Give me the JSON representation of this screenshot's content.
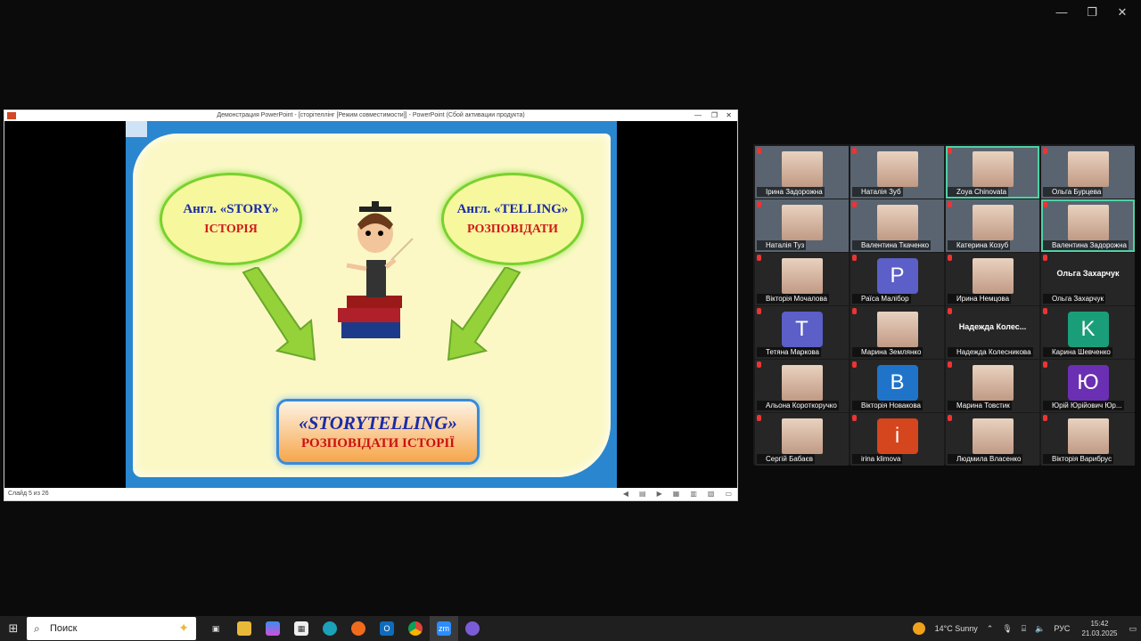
{
  "window_controls": {
    "minimize": "—",
    "maximize": "❐",
    "close": "✕"
  },
  "ppt": {
    "title": "Демонстрация PowerPoint - [сторітеллінг [Режим совместимости]] - PowerPoint (Сбой активации продукта)",
    "status": "Слайд 5 из 26",
    "slide": {
      "left_en": "Англ. «STORY»",
      "left_ua": "ІСТОРІЯ",
      "right_en": "Англ. «TELLING»",
      "right_ua": "РОЗПОВІДАТИ",
      "result_en": "«STORYTELLING»",
      "result_ua": "РОЗПОВІДАТИ ІСТОРІЇ"
    }
  },
  "participants": [
    {
      "name": "Ірина Задорожна",
      "type": "video"
    },
    {
      "name": "Наталія Зуб",
      "type": "video"
    },
    {
      "name": "Zoya Chinovata",
      "type": "video",
      "active": true
    },
    {
      "name": "Ольга Бурцева",
      "type": "video"
    },
    {
      "name": "Наталія Туз",
      "type": "video"
    },
    {
      "name": "Валентина Ткаченко",
      "type": "video"
    },
    {
      "name": "Катерина Козуб",
      "type": "video"
    },
    {
      "name": "Валентина Задорожна",
      "type": "video",
      "active": true
    },
    {
      "name": "Вікторія Мочалова",
      "type": "photo"
    },
    {
      "name": "Раїса Малібор",
      "type": "letter",
      "letter": "P",
      "color": "#5b5fc7"
    },
    {
      "name": "Ирина Немцова",
      "type": "photo"
    },
    {
      "name": "Ольга Захарчук",
      "type": "text",
      "big": "Ольга Захарчук"
    },
    {
      "name": "Тетяна Маркова",
      "type": "letter",
      "letter": "T",
      "color": "#5b5fc7"
    },
    {
      "name": "Марина Землянко",
      "type": "photo"
    },
    {
      "name": "Надежда Колесникова",
      "type": "text",
      "big": "Надежда  Колес..."
    },
    {
      "name": "Карина Шевченко",
      "type": "letter",
      "letter": "K",
      "color": "#1a9e7a"
    },
    {
      "name": "Альона Короткоручко",
      "type": "photo"
    },
    {
      "name": "Вікторія Новакова",
      "type": "letter",
      "letter": "B",
      "color": "#1f74c9"
    },
    {
      "name": "Марина Товстик",
      "type": "photo"
    },
    {
      "name": "Юрій Юрійович Юр...",
      "type": "letter",
      "letter": "Ю",
      "color": "#6b2fb3"
    },
    {
      "name": "Сергій Бабаєв",
      "type": "photo"
    },
    {
      "name": "irina klimova",
      "type": "letter",
      "letter": "i",
      "color": "#d5451e"
    },
    {
      "name": "Людмила Власенко",
      "type": "photo"
    },
    {
      "name": "Вікторія Варибрус",
      "type": "photo"
    }
  ],
  "taskbar": {
    "search_label": "Поиск",
    "weather": "14°C  Sunny",
    "lang": "РУС",
    "time": "15:42",
    "date": "21.03.2025"
  }
}
